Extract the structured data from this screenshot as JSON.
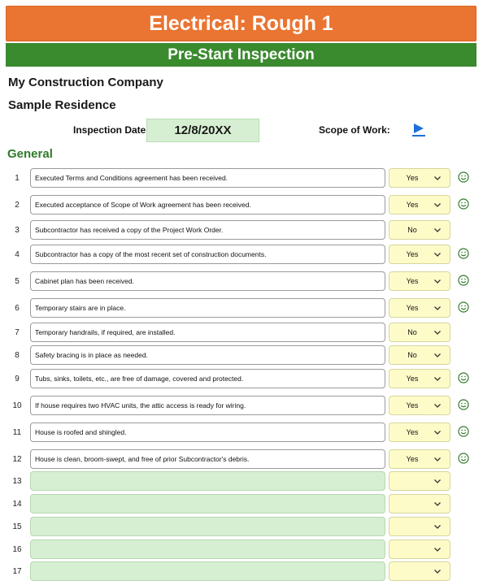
{
  "header": {
    "title": "Electrical: Rough 1",
    "subtitle": "Pre-Start Inspection"
  },
  "info": {
    "company": "My Construction Company",
    "residence": "Sample Residence",
    "inspection_date_label": "Inspection Date:",
    "inspection_date": "12/8/20XX",
    "scope_label": "Scope of Work:"
  },
  "section": {
    "title": "General"
  },
  "colors": {
    "title_bar": "#ea7431",
    "subtitle_bar": "#3a8a2e",
    "input_green": "#d6efd2",
    "select_yellow": "#fdfcc9",
    "link_blue": "#1e6fd9"
  },
  "icons": {
    "dropdown": "chevron-down-icon",
    "status": "smiley-icon",
    "scope_link": "play-triangle-icon"
  },
  "items": [
    {
      "num": "1",
      "text": "Executed Terms and Conditions agreement has been received.",
      "answer": "Yes",
      "smiley": true
    },
    {
      "num": "2",
      "text": "Executed acceptance of Scope of Work agreement has been received.",
      "answer": "Yes",
      "smiley": true
    },
    {
      "num": "3",
      "text": "Subcontractor has received a copy of the Project Work Order.",
      "answer": "No",
      "smiley": false
    },
    {
      "num": "4",
      "text": "Subcontractor has a copy of the most recent set of construction documents.",
      "answer": "Yes",
      "smiley": true
    },
    {
      "num": "5",
      "text": "Cabinet plan has been received.",
      "answer": "Yes",
      "smiley": true
    },
    {
      "num": "6",
      "text": "Temporary stairs are in place.",
      "answer": "Yes",
      "smiley": true
    },
    {
      "num": "7",
      "text": "Temporary handrails, if required, are installed.",
      "answer": "No",
      "smiley": false
    },
    {
      "num": "8",
      "text": "Safety bracing is in place as needed.",
      "answer": "No",
      "smiley": false
    },
    {
      "num": "9",
      "text": "Tubs, sinks, toilets, etc., are free of damage, covered and protected.",
      "answer": "Yes",
      "smiley": true
    },
    {
      "num": "10",
      "text": "If house requires two HVAC units, the attic access is ready for wiring.",
      "answer": "Yes",
      "smiley": true
    },
    {
      "num": "11",
      "text": "House is roofed and shingled.",
      "answer": "Yes",
      "smiley": true
    },
    {
      "num": "12",
      "text": "House is clean, broom-swept, and free of prior Subcontractor's debris.",
      "answer": "Yes",
      "smiley": true
    },
    {
      "num": "13",
      "text": "",
      "answer": "",
      "smiley": false
    },
    {
      "num": "14",
      "text": "",
      "answer": "",
      "smiley": false
    },
    {
      "num": "15",
      "text": "",
      "answer": "",
      "smiley": false
    },
    {
      "num": "16",
      "text": "",
      "answer": "",
      "smiley": false
    },
    {
      "num": "17",
      "text": "",
      "answer": "",
      "smiley": false
    }
  ]
}
